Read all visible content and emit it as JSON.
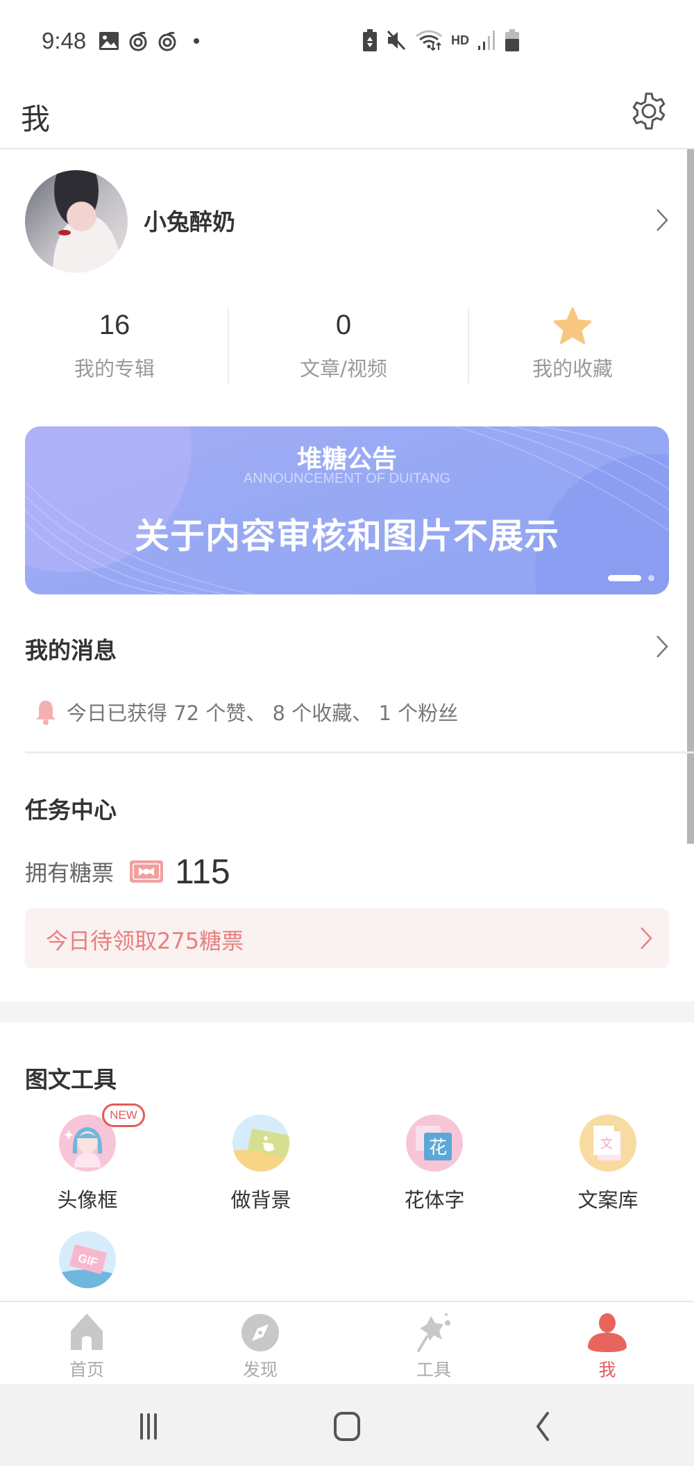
{
  "status_bar": {
    "time": "9:48",
    "left_icons": [
      "gallery-icon",
      "swirl-app-icon",
      "swirl-app-icon",
      "dot-icon"
    ],
    "right_icons": [
      "battery-saver-icon",
      "mute-icon",
      "wifi-icon",
      "hd-icon",
      "signal-icon",
      "battery-icon"
    ],
    "hd_label": "HD"
  },
  "header": {
    "title": "我",
    "settings_icon": "gear-icon"
  },
  "profile": {
    "username": "小兔醉奶"
  },
  "stats": [
    {
      "value": "16",
      "label": "我的专辑"
    },
    {
      "value": "0",
      "label": "文章/视频"
    },
    {
      "icon": "star-icon",
      "label": "我的收藏"
    }
  ],
  "banner": {
    "title": "堆糖公告",
    "subtitle": "ANNOUNCEMENT OF DUITANG",
    "headline": "关于内容审核和图片不展示",
    "page_count": 2,
    "active_page": 1
  },
  "messages": {
    "title": "我的消息",
    "summary": "今日已获得 72 个赞、 8 个收藏、 1 个粉丝"
  },
  "tasks": {
    "title": "任务中心",
    "candy_label": "拥有糖票",
    "candy_count": "115",
    "claim_text": "今日待领取275糖票"
  },
  "tools": {
    "title": "图文工具",
    "items": [
      {
        "label": "头像框",
        "icon": "avatar-frame-icon",
        "badge": "NEW"
      },
      {
        "label": "做背景",
        "icon": "background-icon"
      },
      {
        "label": "花体字",
        "icon": "fancy-text-icon",
        "glyph": "花"
      },
      {
        "label": "文案库",
        "icon": "copywriting-icon",
        "glyph": "文"
      },
      {
        "label": "",
        "icon": "gif-icon",
        "glyph": "GIF"
      }
    ]
  },
  "bottom_nav": [
    {
      "label": "首页",
      "icon": "home-icon",
      "active": false
    },
    {
      "label": "发现",
      "icon": "compass-icon",
      "active": false
    },
    {
      "label": "工具",
      "icon": "magic-wand-icon",
      "active": false
    },
    {
      "label": "我",
      "icon": "person-icon",
      "active": true
    }
  ],
  "colors": {
    "accent": "#e45a5a",
    "claim_text": "#e87f7f",
    "claim_bg": "#faf1f1",
    "banner": "#98a9f4",
    "star": "#f7c77f",
    "nav_inactive": "#c8c8c8"
  }
}
